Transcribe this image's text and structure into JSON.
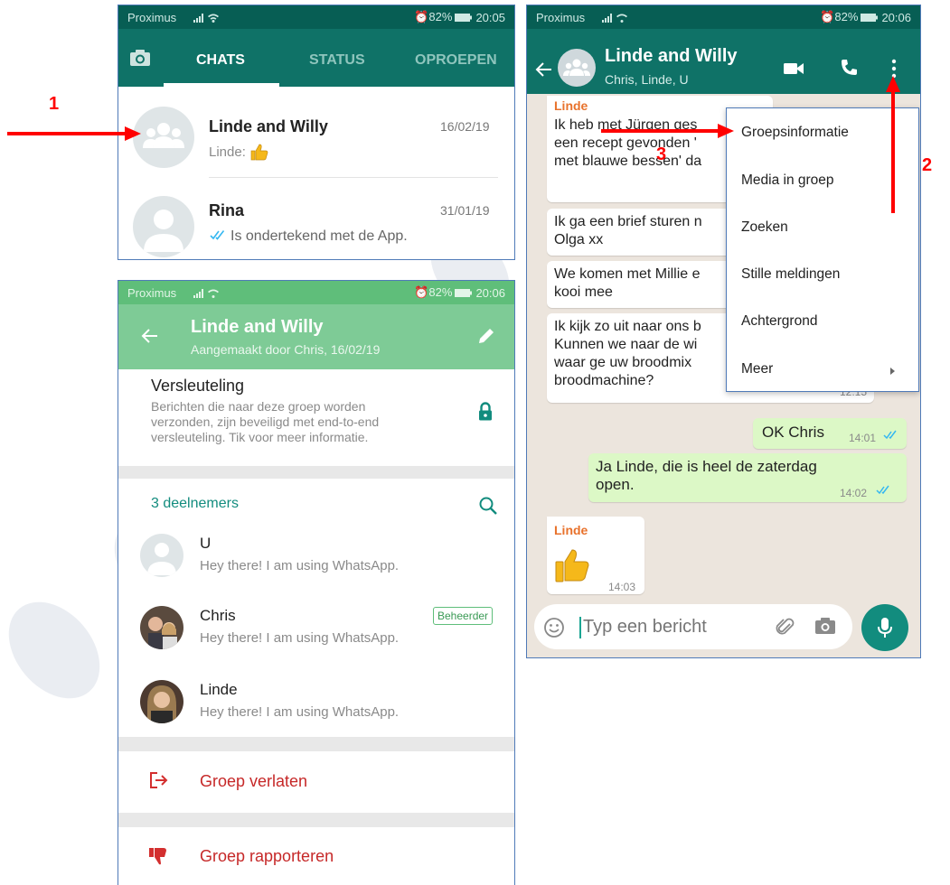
{
  "annotations": {
    "n1": "1",
    "n2": "2",
    "n3": "3"
  },
  "colors": {
    "whatsapp_dark": "#075e54",
    "whatsapp_header": "#0f7267",
    "info_header": "#7ecb96",
    "info_statusbar": "#5fbe7a",
    "accent": "#128c7e",
    "tick_blue": "#34b7f1",
    "danger": "#d32f2f",
    "annotation": "#ff0000"
  },
  "chats_screen": {
    "status_bar": {
      "carrier": "Proximus",
      "alarm_battery": "⏰82%",
      "time": "20:05"
    },
    "tabs": {
      "camera_icon": "camera-icon",
      "chats": "CHATS",
      "status": "STATUS",
      "calls": "OPROEPEN"
    },
    "chats": [
      {
        "name": "Linde and Willy",
        "date": "16/02/19",
        "preview": "Linde:",
        "preview_icon": "thumbs-up-emoji"
      },
      {
        "name": "Rina",
        "date": "31/01/19",
        "preview": "Is ondertekend met de App."
      }
    ]
  },
  "info_screen": {
    "status_bar": {
      "carrier": "Proximus",
      "alarm_battery": "⏰82%",
      "time": "20:06"
    },
    "header": {
      "title": "Linde and Willy",
      "subtitle": "Aangemaakt door Chris, 16/02/19"
    },
    "encryption": {
      "title": "Versleuteling",
      "text": "Berichten die naar deze groep worden verzonden, zijn beveiligd met end-to-end versleuteling. Tik voor meer informatie."
    },
    "participants": {
      "count_label": "3 deelnemers",
      "admin_badge": "Beheerder",
      "members": [
        {
          "name": "U",
          "status": "Hey there! I am using WhatsApp."
        },
        {
          "name": "Chris",
          "status": "Hey there! I am using WhatsApp."
        },
        {
          "name": "Linde",
          "status": "Hey there! I am using WhatsApp."
        }
      ]
    },
    "actions": {
      "leave": "Groep verlaten",
      "report": "Groep rapporteren"
    }
  },
  "chat_screen": {
    "status_bar": {
      "carrier": "Proximus",
      "alarm_battery": "⏰82%",
      "time": "20:06"
    },
    "header": {
      "title": "Linde and Willy",
      "subtitle": "Chris, Linde, U"
    },
    "messages": {
      "m1_sender": "Linde",
      "m1_l1": "Ik heb met  Jürgen ges",
      "m1_l2": "een recept gevonden '",
      "m1_l3": "met blauwe bessen' da",
      "m2_l1": "Ik ga een brief sturen n",
      "m2_l2": "Olga xx",
      "m3_l1": "We komen met Millie e",
      "m3_l2": "kooi mee",
      "m4_l1": "Ik kijk zo uit naar ons b",
      "m4_l2": "Kunnen we naar de wi",
      "m4_l3": "waar ge uw broodmix",
      "m4_l4": "broodmachine?",
      "m4_time": "12:15",
      "m5_text": "OK Chris",
      "m5_time": "14:01",
      "m6_l1": "Ja Linde, die is heel de zaterdag",
      "m6_l2": "open.",
      "m6_time": "14:02",
      "m7_sender": "Linde",
      "m7_time": "14:03"
    },
    "input": {
      "placeholder": "Typ een bericht"
    },
    "menu": [
      "Groepsinformatie",
      "Media in groep",
      "Zoeken",
      "Stille meldingen",
      "Achtergrond",
      "Meer"
    ]
  }
}
